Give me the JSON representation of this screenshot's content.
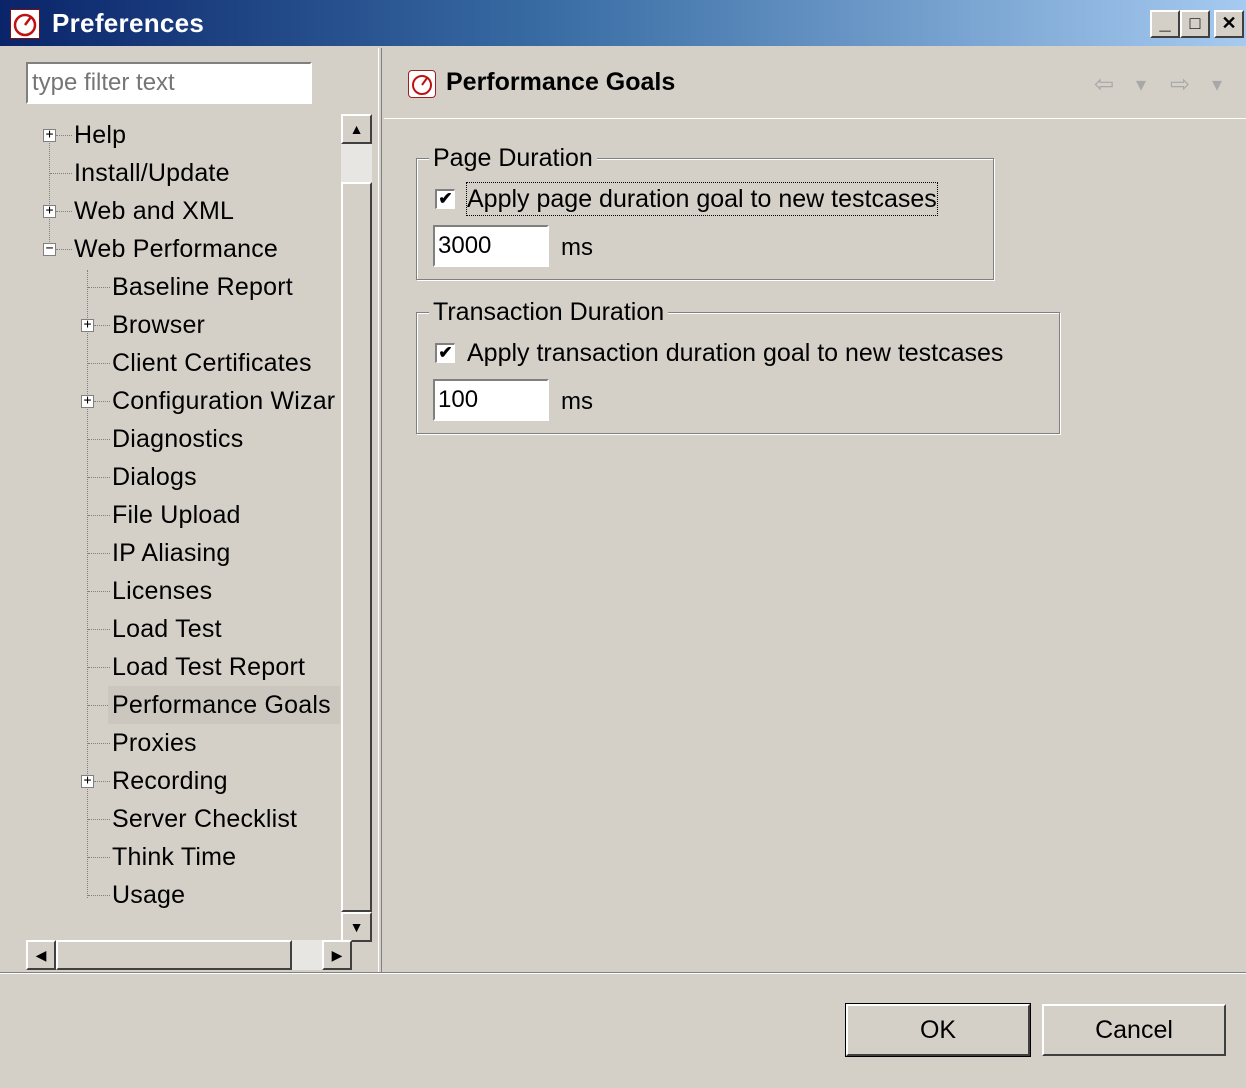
{
  "window": {
    "title": "Preferences",
    "minimize": "_",
    "maximize": "□",
    "close": "✕"
  },
  "sidebar": {
    "filter_placeholder": "type filter text",
    "tree": [
      {
        "label": "Help",
        "expander": "+"
      },
      {
        "label": "Install/Update"
      },
      {
        "label": "Web and XML",
        "expander": "+"
      },
      {
        "label": "Web Performance",
        "expander": "−"
      },
      {
        "label": "Baseline Report"
      },
      {
        "label": "Browser",
        "expander": "+"
      },
      {
        "label": "Client Certificates"
      },
      {
        "label": "Configuration Wizar",
        "expander": "+"
      },
      {
        "label": "Diagnostics"
      },
      {
        "label": "Dialogs"
      },
      {
        "label": "File Upload"
      },
      {
        "label": "IP Aliasing"
      },
      {
        "label": "Licenses"
      },
      {
        "label": "Load Test"
      },
      {
        "label": "Load Test Report"
      },
      {
        "label": "Performance Goals",
        "selected": true
      },
      {
        "label": "Proxies"
      },
      {
        "label": "Recording",
        "expander": "+"
      },
      {
        "label": "Server Checklist"
      },
      {
        "label": "Think Time"
      },
      {
        "label": "Usage"
      }
    ],
    "scroll_up": "▲",
    "scroll_down": "▼",
    "scroll_left": "◀",
    "scroll_right": "▶"
  },
  "page": {
    "title": "Performance Goals",
    "icon": "gauge-icon",
    "nav": {
      "back": "⇦",
      "back_menu": "▾",
      "forward": "⇨",
      "forward_menu": "▾"
    }
  },
  "page_duration": {
    "group_label": "Page Duration",
    "checkbox_label": "Apply page duration goal to new testcases",
    "checked": true,
    "check_mark": "✔",
    "value": "3000",
    "unit": "ms"
  },
  "transaction_duration": {
    "group_label": "Transaction Duration",
    "checkbox_label": "Apply transaction duration goal to new testcases",
    "checked": true,
    "check_mark": "✔",
    "value": "100",
    "unit": "ms"
  },
  "buttons": {
    "ok": "OK",
    "cancel": "Cancel"
  }
}
